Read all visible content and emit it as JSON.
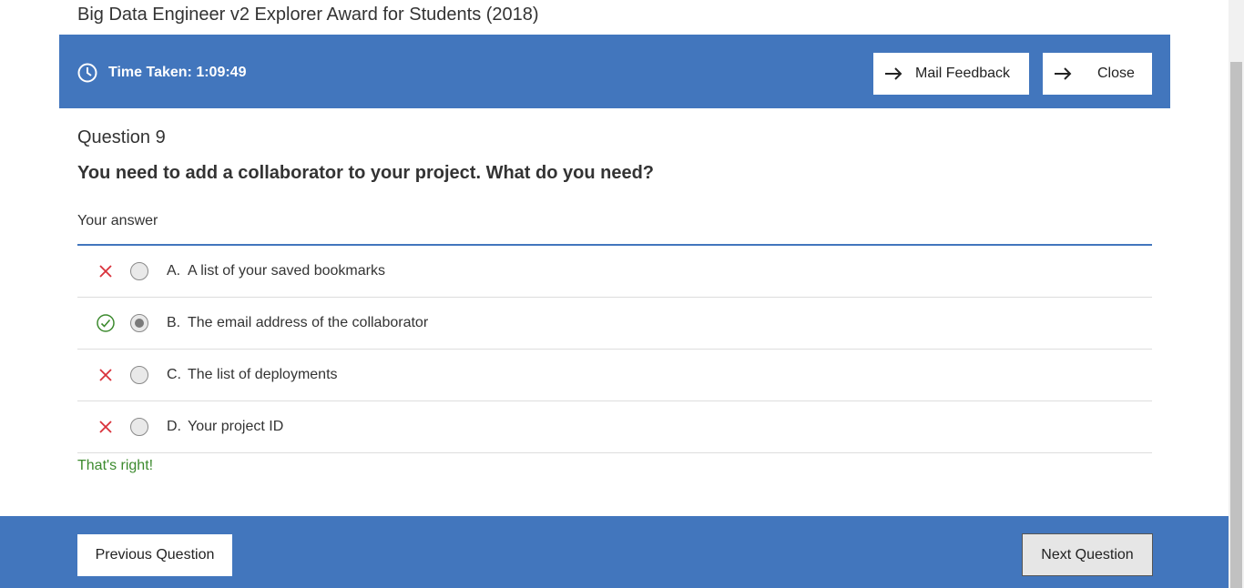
{
  "page": {
    "title": "Big Data Engineer v2 Explorer Award for Students (2018)"
  },
  "toolbar": {
    "timer_text": "Time Taken: 1:09:49",
    "mail_feedback_label": "Mail Feedback",
    "close_label": "Close"
  },
  "question": {
    "number_label": "Question 9",
    "text": "You need to add a collaborator to your project. What do you need?",
    "answer_label": "Your answer",
    "options": [
      {
        "letter": "A.",
        "text": "A list of your saved bookmarks",
        "status": "incorrect",
        "selected": false
      },
      {
        "letter": "B.",
        "text": "The email address of the collaborator",
        "status": "correct",
        "selected": true
      },
      {
        "letter": "C.",
        "text": "The list of deployments",
        "status": "incorrect",
        "selected": false
      },
      {
        "letter": "D.",
        "text": "Your project ID",
        "status": "incorrect",
        "selected": false
      }
    ],
    "feedback": "That's right!"
  },
  "footer": {
    "previous_label": "Previous Question",
    "next_label": "Next Question"
  },
  "colors": {
    "accent": "#4276bd",
    "correct": "#3c8a2e",
    "incorrect": "#d9313a"
  },
  "icons": {
    "timer": "clock-icon",
    "buttons": "arrow-right-icon",
    "correct": "check-circle-icon",
    "incorrect": "x-icon"
  }
}
